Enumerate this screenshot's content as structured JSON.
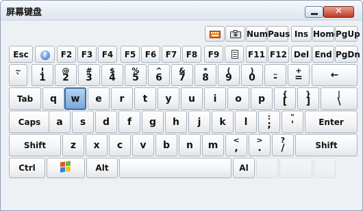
{
  "window": {
    "title": "屏幕键盘",
    "close_label": "✕"
  },
  "keys": {
    "row0": {
      "numlock": "Num",
      "pause": "Paus",
      "ins": "Ins",
      "home": "Home",
      "pgup": "PgUp"
    },
    "row1": {
      "esc": "Esc",
      "f2": "F2",
      "f3": "F3",
      "f4": "F4",
      "f5": "F5",
      "f6": "F6",
      "f7": "F7",
      "f8": "F8",
      "f9": "F9",
      "f11": "F11",
      "f12": "F12",
      "del": "Del",
      "end": "End",
      "pgdn": "PgDn"
    },
    "row2": {
      "tilde_top": "~",
      "tilde_bot": "`",
      "k1_top": "!",
      "k1": "1",
      "k2_top": "@",
      "k2": "2",
      "k3_top": "#",
      "k3": "3",
      "k4_top": "$",
      "k4": "4",
      "k5_top": "%",
      "k5": "5",
      "k6_top": "^",
      "k6": "6",
      "k7_top": "&",
      "k7": "7",
      "k8_top": "*",
      "k8": "8",
      "k9_top": "(",
      "k9": "9",
      "k0_top": ")",
      "k0": "0",
      "minus_top": "_",
      "minus": "-",
      "plus_top": "+",
      "plus": "=",
      "backspace": "←"
    },
    "row3": {
      "tab": "Tab",
      "q": "q",
      "w": "w",
      "e": "e",
      "r": "r",
      "t": "t",
      "y": "y",
      "u": "u",
      "i": "i",
      "o": "o",
      "p": "p",
      "lbrace": "{",
      "lbracket": "[",
      "rbrace": "}",
      "rbracket": "]",
      "pipe": "|",
      "backslash": "\\"
    },
    "row4": {
      "caps": "Caps",
      "a": "a",
      "s": "s",
      "d": "d",
      "f": "f",
      "g": "g",
      "h": "h",
      "j": "j",
      "k": "k",
      "l": "l",
      "colon": ":",
      "semicolon": ";",
      "quote_top": "\"",
      "quote": "'",
      "enter": "Enter"
    },
    "row5": {
      "lshift": "Shift",
      "z": "z",
      "x": "x",
      "c": "c",
      "v": "v",
      "b": "b",
      "n": "n",
      "m": "m",
      "lt": "<",
      "comma": ",",
      "gt": ">",
      "period": ".",
      "question": "?",
      "slash": "/",
      "rshift": "Shift"
    },
    "row6": {
      "ctrl": "Ctrl",
      "alt": "Alt",
      "alt_right": "Al"
    }
  },
  "selected_key": "w",
  "colors": {
    "selected": "#7ba6d6",
    "window_border": "#8a9db3",
    "close": "#c23a22"
  }
}
